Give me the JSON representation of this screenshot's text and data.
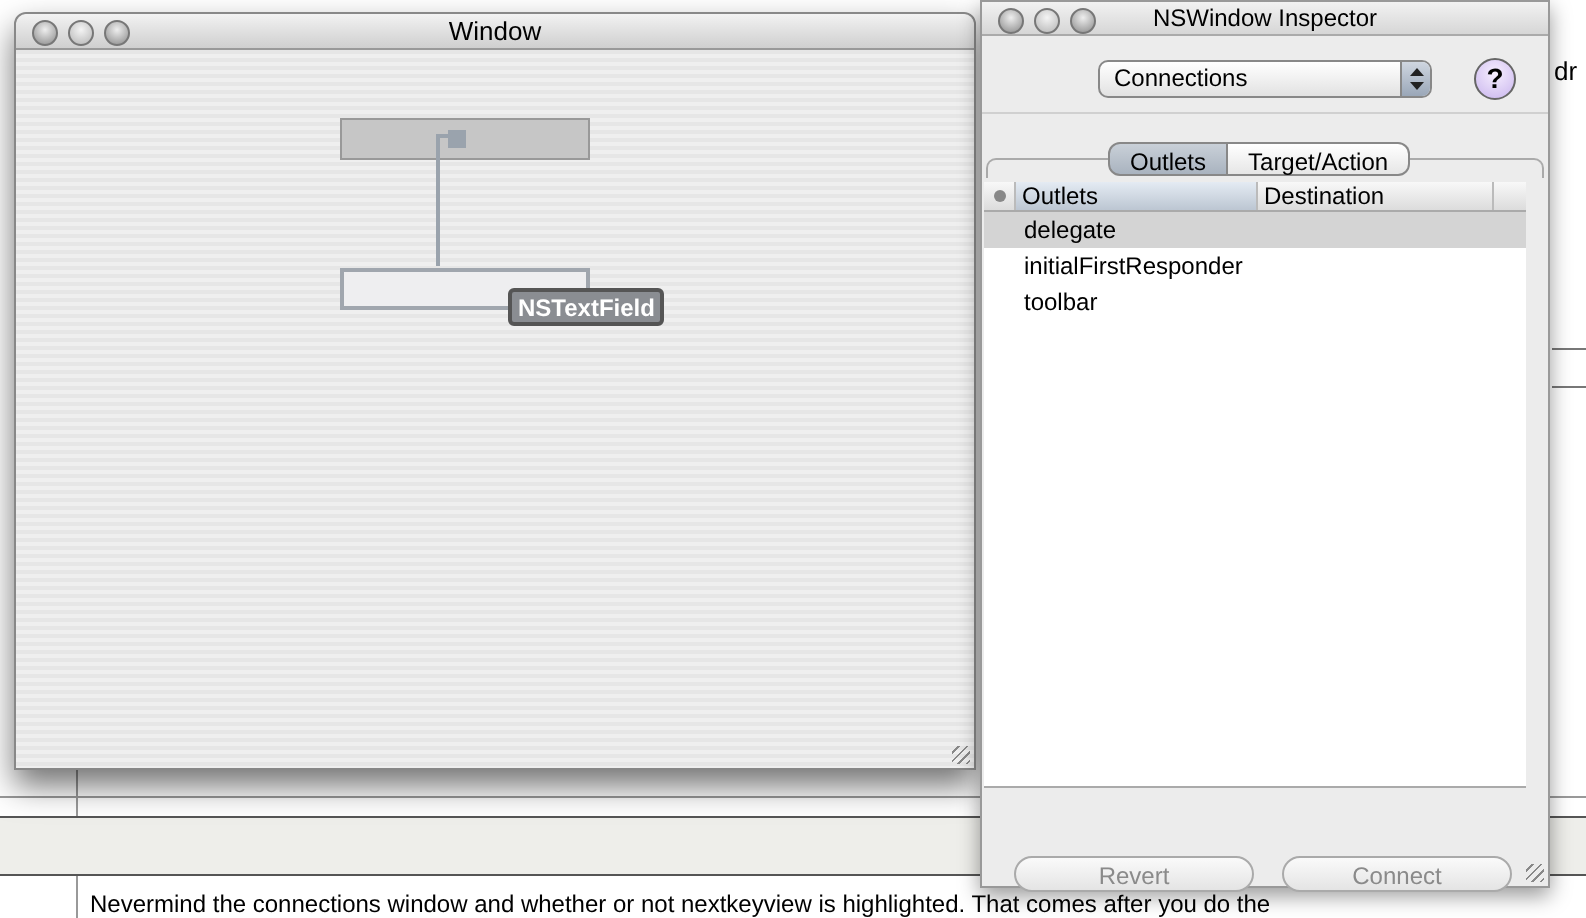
{
  "background": {
    "fragment": "dr",
    "paragraph": "Nevermind the connections window and whether or not nextkeyview is highlighted. That comes after you do the"
  },
  "window": {
    "title": "Window",
    "badge": "NSTextField"
  },
  "inspector": {
    "title": "NSWindow Inspector",
    "popup": "Connections",
    "help": "?",
    "tabs": [
      {
        "label": "Outlets",
        "selected": true
      },
      {
        "label": "Target/Action",
        "selected": false
      }
    ],
    "columns": [
      "Outlets",
      "Destination"
    ],
    "rows": [
      {
        "name": "delegate",
        "selected": true
      },
      {
        "name": "initialFirstResponder",
        "selected": false
      },
      {
        "name": "toolbar",
        "selected": false
      }
    ],
    "buttons": [
      {
        "label": "Revert",
        "disabled": true
      },
      {
        "label": "Connect",
        "disabled": true
      }
    ]
  }
}
